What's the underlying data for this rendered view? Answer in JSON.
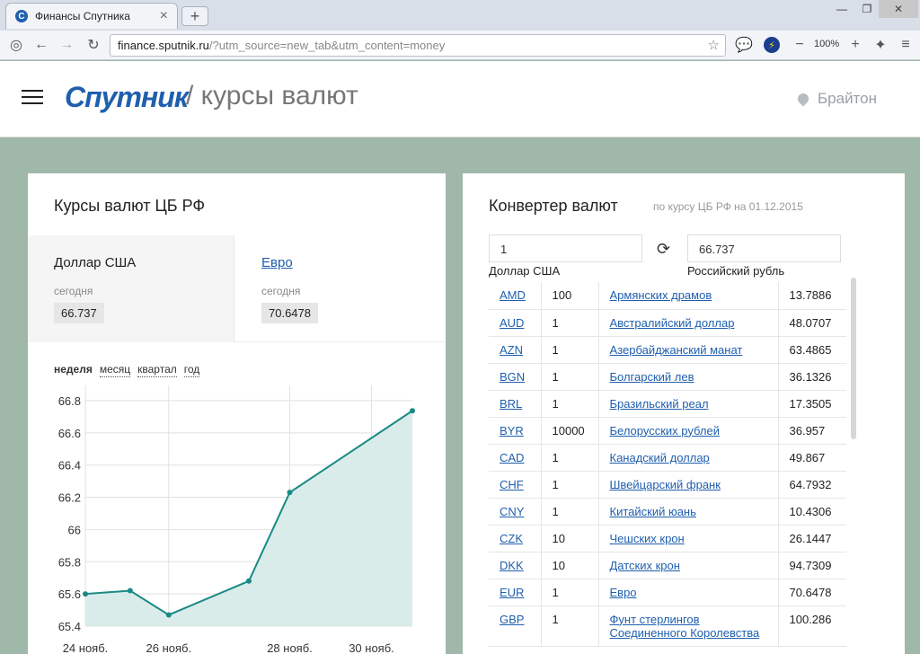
{
  "browser": {
    "tab_title": "Финансы Спутника",
    "favicon": "С",
    "new_tab": "+",
    "url_host": "finance.sputnik.ru",
    "url_path": "/?utm_source=new_tab&utm_content=money",
    "zoom": "100%",
    "win_min": "—",
    "win_max": "❐",
    "win_close": "✕"
  },
  "header": {
    "logo": "Спутник",
    "title": "/ курсы валют",
    "city": "Брайтон"
  },
  "rates": {
    "heading": "Курсы валют ЦБ РФ",
    "tabs": [
      {
        "name": "Доллар США",
        "label": "сегодня",
        "value": "66.737"
      },
      {
        "name": "Евро",
        "label": "сегодня",
        "value": "70.6478"
      }
    ],
    "periods": [
      "неделя",
      "месяц",
      "квартал",
      "год"
    ]
  },
  "chart_data": {
    "type": "area",
    "x": [
      "24 нояб.",
      "25 нояб.",
      "26 нояб.",
      "27 нояб.",
      "28 нояб.",
      "1 дек."
    ],
    "values": [
      65.6,
      65.62,
      65.47,
      65.68,
      66.23,
      66.737
    ],
    "xticks": [
      "24 нояб.",
      "26 нояб.",
      "28 нояб.",
      "30 нояб."
    ],
    "yticks": [
      "65.4",
      "65.6",
      "65.8",
      "66",
      "66.2",
      "66.4",
      "66.6",
      "66.8"
    ],
    "ylim": [
      65.4,
      66.85
    ],
    "grid": true,
    "line_color": "#1a8a86",
    "fill_color": "#d9ecea"
  },
  "converter": {
    "heading": "Конвертер валют",
    "subtitle": "по курсу ЦБ РФ на 01.12.2015",
    "from_value": "1",
    "from_label": "Доллар США",
    "to_value": "66.737",
    "to_label": "Российский рубль",
    "swap_icon": "⟳",
    "rows": [
      {
        "code": "AMD",
        "nominal": "100",
        "name": "Армянских драмов",
        "rate": "13.7886"
      },
      {
        "code": "AUD",
        "nominal": "1",
        "name": "Австралийский доллар",
        "rate": "48.0707"
      },
      {
        "code": "AZN",
        "nominal": "1",
        "name": "Азербайджанский манат",
        "rate": "63.4865"
      },
      {
        "code": "BGN",
        "nominal": "1",
        "name": "Болгарский лев",
        "rate": "36.1326"
      },
      {
        "code": "BRL",
        "nominal": "1",
        "name": "Бразильский реал",
        "rate": "17.3505"
      },
      {
        "code": "BYR",
        "nominal": "10000",
        "name": "Белорусских рублей",
        "rate": "36.957"
      },
      {
        "code": "CAD",
        "nominal": "1",
        "name": "Канадский доллар",
        "rate": "49.867"
      },
      {
        "code": "CHF",
        "nominal": "1",
        "name": "Швейцарский франк",
        "rate": "64.7932"
      },
      {
        "code": "CNY",
        "nominal": "1",
        "name": "Китайский юань",
        "rate": "10.4306"
      },
      {
        "code": "CZK",
        "nominal": "10",
        "name": "Чешских крон",
        "rate": "26.1447"
      },
      {
        "code": "DKK",
        "nominal": "10",
        "name": "Датских крон",
        "rate": "94.7309"
      },
      {
        "code": "EUR",
        "nominal": "1",
        "name": "Евро",
        "rate": "70.6478"
      },
      {
        "code": "GBP",
        "nominal": "1",
        "name": "Фунт стерлингов Соединенного Королевства",
        "rate": "100.286"
      }
    ]
  }
}
